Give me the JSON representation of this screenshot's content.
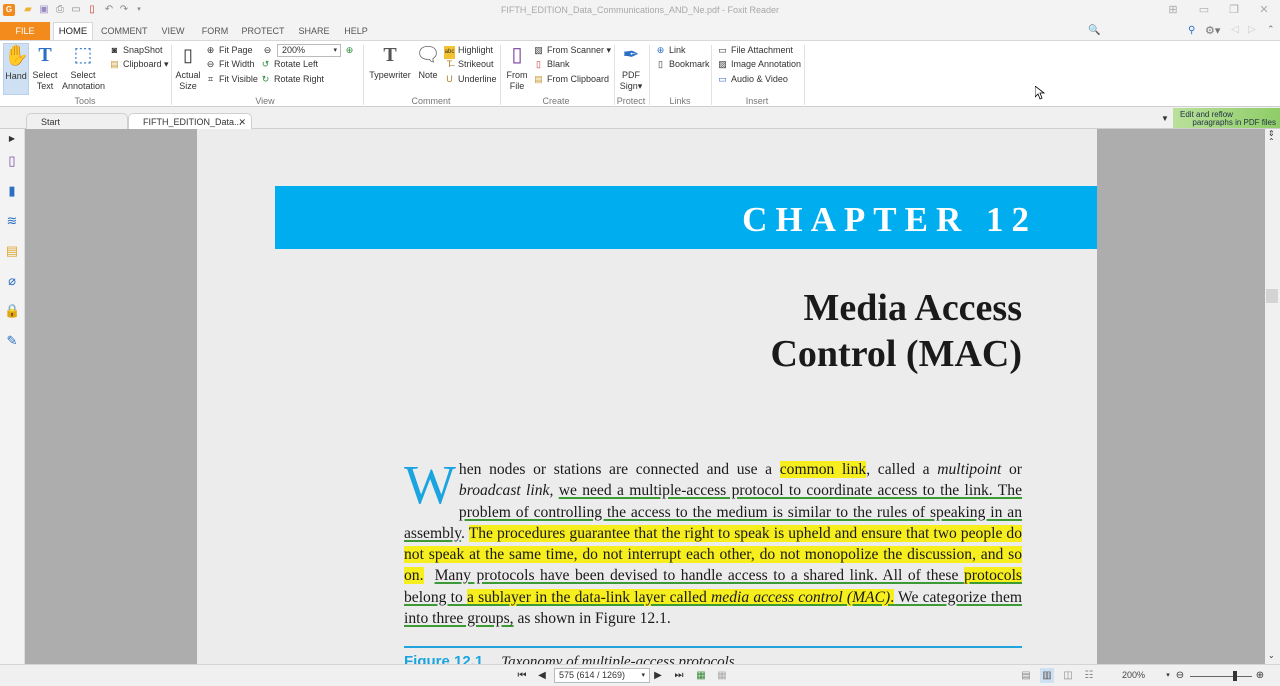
{
  "window": {
    "title": "FIFTH_EDITION_Data_Communications_AND_Ne.pdf - Foxit Reader"
  },
  "menu": {
    "tabs": [
      "FILE",
      "HOME",
      "COMMENT",
      "VIEW",
      "FORM",
      "PROTECT",
      "SHARE",
      "HELP"
    ],
    "active": "HOME"
  },
  "ribbon": {
    "tools": {
      "label": "Tools",
      "hand": "Hand",
      "select_text": [
        "Select",
        "Text"
      ],
      "select_annotation": [
        "Select",
        "Annotation"
      ],
      "snapshot": "SnapShot",
      "clipboard": "Clipboard"
    },
    "view": {
      "label": "View",
      "actual_size": [
        "Actual",
        "Size"
      ],
      "fit_page": "Fit Page",
      "fit_width": "Fit Width",
      "fit_visible": "Fit Visible",
      "zoom_value": "200%",
      "rotate_left": "Rotate Left",
      "rotate_right": "Rotate Right"
    },
    "comment": {
      "label": "Comment",
      "typewriter": "Typewriter",
      "note": "Note",
      "highlight": "Highlight",
      "strikeout": "Strikeout",
      "underline": "Underline"
    },
    "create": {
      "label": "Create",
      "from_file": [
        "From",
        "File"
      ],
      "from_scanner": "From Scanner",
      "blank": "Blank",
      "from_clipboard": "From Clipboard"
    },
    "protect": {
      "label": "Protect",
      "pdf_sign": [
        "PDF",
        "Sign"
      ]
    },
    "links": {
      "label": "Links",
      "link": "Link",
      "bookmark": "Bookmark"
    },
    "insert": {
      "label": "Insert",
      "file_attachment": "File Attachment",
      "image_annotation": "Image Annotation",
      "audio_video": "Audio & Video"
    }
  },
  "search": {
    "placeholder": "Find"
  },
  "doc_tabs": [
    {
      "label": "Start"
    },
    {
      "label": "FIFTH_EDITION_Data...",
      "active": true
    }
  ],
  "promo": [
    "Edit and reflow",
    "paragraphs in PDF files"
  ],
  "document": {
    "banner": "CHAPTER 12",
    "title_line1": "Media Access",
    "title_line2": "Control (MAC)",
    "dropcap": "W",
    "figure_number": "Figure 12.1",
    "figure_title": "Taxonomy of multiple-access protocols"
  },
  "status": {
    "page_display": "575 (614 / 1269)",
    "zoom": "200%",
    "zoom_slider_fraction": 0.72
  },
  "colors": {
    "file_tab": "#f28a1c",
    "banner": "#00aeef",
    "highlight": "#f6ee1d",
    "underline": "#3d9b35"
  }
}
